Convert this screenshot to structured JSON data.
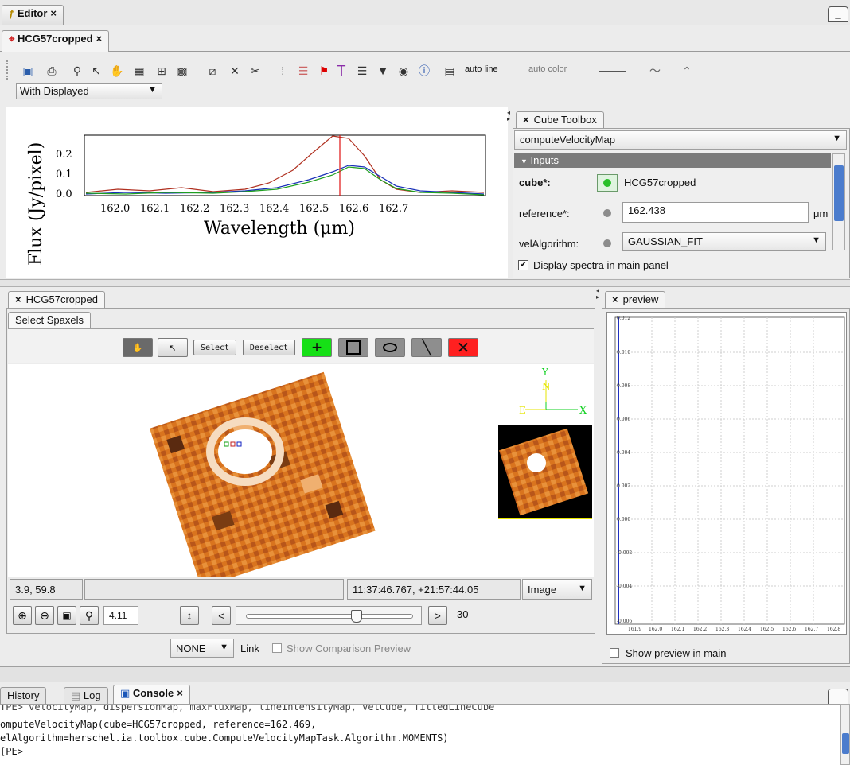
{
  "editor_tab": "Editor",
  "doc_tab": "HCG57cropped",
  "toolbar": {
    "display_mode": "With Displayed",
    "auto_line": "auto line",
    "auto_color": "auto color"
  },
  "spectrum_plot": {
    "ylabel": "Flux (Jy/pixel)",
    "xlabel": "Wavelength (μm)",
    "xticks": [
      "162.0",
      "162.1",
      "162.2",
      "162.3",
      "162.4",
      "162.5",
      "162.6",
      "162.7"
    ],
    "yticks": [
      "0.0",
      "0.1",
      "0.2"
    ]
  },
  "cube_toolbox": {
    "title": "Cube Toolbox",
    "task": "computeVelocityMap",
    "inputs_header": "Inputs",
    "cube_label": "cube*:",
    "cube_value": "HCG57cropped",
    "reference_label": "reference*:",
    "reference_value": "162.438",
    "reference_unit": "μm",
    "vel_label": "velAlgorithm:",
    "vel_value": "GAUSSIAN_FIT",
    "display_spectra": "Display spectra in main panel"
  },
  "image_panel": {
    "tab": "HCG57cropped",
    "subtab": "Select Spaxels",
    "select_btn": "Select",
    "deselect_btn": "Deselect",
    "pixel_coords": "3.9, 59.8",
    "sky_coords": "11:37:46.767, +21:57:44.05",
    "view_mode": "Image",
    "zoom": "4.11",
    "slider_max": "30",
    "compass_y": "Y",
    "compass_n": "N",
    "compass_e": "E",
    "compass_x": "X",
    "compare_select": "NONE",
    "link_label": "Link",
    "show_comparison": "Show Comparison Preview"
  },
  "preview_panel": {
    "tab": "preview",
    "yticks": [
      "0.012",
      "0.010",
      "0.008",
      "0.006",
      "0.004",
      "0.002",
      "0.000",
      "-0.002",
      "-0.004",
      "-0.006"
    ],
    "xticks": [
      "161.9",
      "162.0",
      "162.1",
      "162.2",
      "162.3",
      "162.4",
      "162.5",
      "162.6",
      "162.7",
      "162.8"
    ],
    "show_preview": "Show preview in main"
  },
  "bottom_tabs": {
    "history": "History",
    "log": "Log",
    "console": "Console"
  },
  "console_lines": [
    "TPE> velocityMap, dispersionMap, maxFluxMap, lineIntensityMap, velCube, fittedLineCube",
    "omputeVelocityMap(cube=HCG57cropped, reference=162.469,",
    "elAlgorithm=herschel.ia.toolbox.cube.ComputeVelocityMapTask.Algorithm.MOMENTS)",
    "[PE>"
  ],
  "colors": {
    "accent_green": "#00e000",
    "accent_red": "#ff2020",
    "inputs_header": "#7b7b7b",
    "orange": "#e07a1f"
  }
}
